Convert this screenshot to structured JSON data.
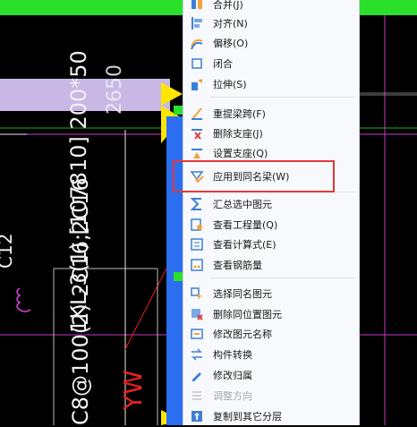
{
  "cad": {
    "text_dims": "1KL-3(1) [107810] 200*50",
    "text_rebar": "C8@100(2) 2C16;2C16",
    "text_num": "2650",
    "text_c12": "C12",
    "text_yw": "YW"
  },
  "menu": {
    "items": [
      {
        "label": "合并(J)",
        "name": "merge",
        "icon": "merge-icon",
        "disabled": false
      },
      {
        "label": "对齐(N)",
        "name": "align",
        "icon": "align-icon",
        "disabled": false
      },
      {
        "label": "偏移(O)",
        "name": "offset",
        "icon": "offset-icon",
        "disabled": false
      },
      {
        "label": "闭合",
        "name": "close",
        "icon": "close-shape-icon",
        "disabled": false
      },
      {
        "label": "拉伸(S)",
        "name": "stretch",
        "icon": "stretch-icon",
        "disabled": false
      },
      {
        "label": "重提梁跨(F)",
        "name": "re-extract-span",
        "icon": "beam-span-icon",
        "disabled": false
      },
      {
        "label": "删除支座(J)",
        "name": "delete-support",
        "icon": "delete-support-icon",
        "disabled": false
      },
      {
        "label": "设置支座(Q)",
        "name": "set-support",
        "icon": "set-support-icon",
        "disabled": false
      },
      {
        "label": "应用到同名梁(W)",
        "name": "apply-same-beam",
        "icon": "apply-beam-icon",
        "disabled": false
      },
      {
        "label": "汇总选中图元",
        "name": "summarize-selected",
        "icon": "sigma-icon",
        "disabled": false
      },
      {
        "label": "查看工程量(Q)",
        "name": "view-quantity",
        "icon": "quantity-icon",
        "disabled": false
      },
      {
        "label": "查看计算式(E)",
        "name": "view-formula",
        "icon": "formula-icon",
        "disabled": false
      },
      {
        "label": "查看钢筋量",
        "name": "view-rebar",
        "icon": "rebar-icon",
        "disabled": false
      },
      {
        "label": "选择同名图元",
        "name": "select-same-name",
        "icon": "select-same-icon",
        "disabled": false
      },
      {
        "label": "删除同位置图元",
        "name": "delete-same-position",
        "icon": "delete-position-icon",
        "disabled": false
      },
      {
        "label": "修改图元名称",
        "name": "rename-element",
        "icon": "rename-icon",
        "disabled": false
      },
      {
        "label": "构件转换",
        "name": "convert-component",
        "icon": "convert-icon",
        "disabled": false
      },
      {
        "label": "修改归属",
        "name": "modify-ownership",
        "icon": "ownership-icon",
        "disabled": false
      },
      {
        "label": "调整方向",
        "name": "adjust-direction",
        "icon": "direction-icon",
        "disabled": true
      },
      {
        "label": "复制到其它分层",
        "name": "copy-to-layer",
        "icon": "copy-layer-icon",
        "disabled": false
      }
    ]
  },
  "colors": {
    "green": "#2be02b",
    "purple_band": "#c9b8e6",
    "yellow": "#ffe600",
    "blue": "#2b6ef0",
    "highlight": "#e0393a",
    "menu_bg": "#f7f9fc"
  }
}
